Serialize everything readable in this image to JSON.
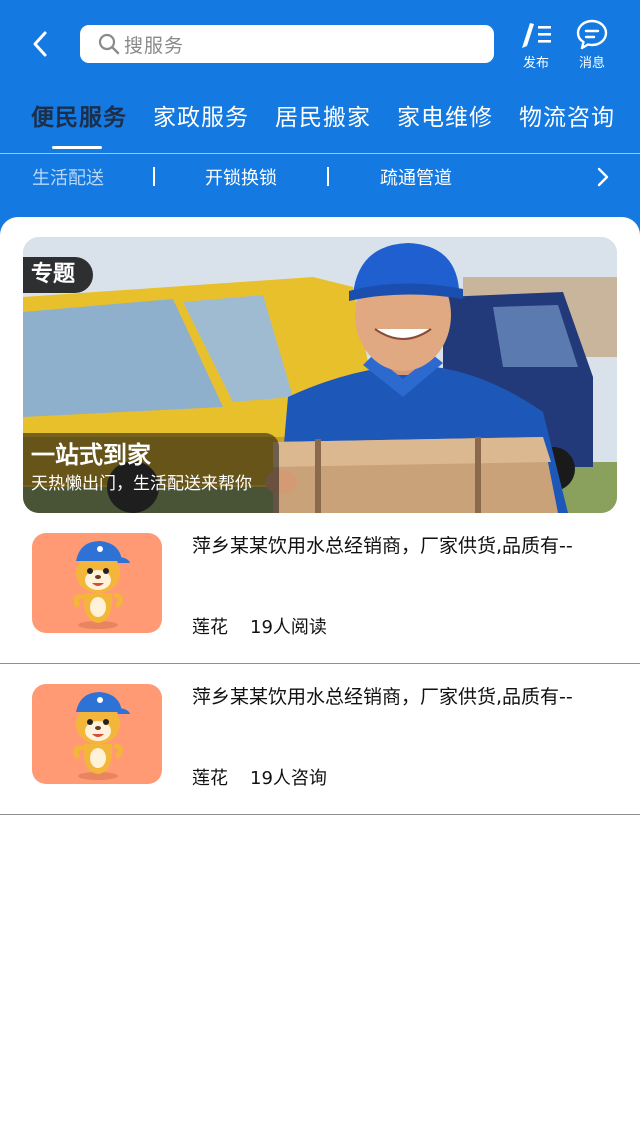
{
  "header": {
    "search_placeholder": "搜服务",
    "publish_label": "发布",
    "messages_label": "消息"
  },
  "main_tabs": [
    {
      "label": "便民服务",
      "active": true
    },
    {
      "label": "家政服务",
      "active": false
    },
    {
      "label": "居民搬家",
      "active": false
    },
    {
      "label": "家电维修",
      "active": false
    },
    {
      "label": "物流咨询",
      "active": false
    }
  ],
  "sub_tabs": [
    {
      "label": "生活配送",
      "active": true
    },
    {
      "label": "开锁换锁",
      "active": false
    },
    {
      "label": "疏通管道",
      "active": false
    }
  ],
  "banner": {
    "tag": "专题",
    "title": "一站式到家",
    "subtitle": "天热懒出门，生活配送来帮你"
  },
  "list": [
    {
      "title": "萍乡某某饮用水总经销商，厂家供货,品质有--",
      "author": "莲花",
      "stat": "19人阅读"
    },
    {
      "title": "萍乡某某饮用水总经销商，厂家供货,品质有--",
      "author": "莲花",
      "stat": "19人咨询"
    }
  ],
  "colors": {
    "brand_blue": "#1479e0",
    "thumb_bg": "#ff9a74",
    "active_tab_text": "#1c2f4a"
  },
  "icons": [
    "back-arrow-icon",
    "search-icon",
    "publish-icon",
    "message-icon",
    "chevron-right-icon"
  ]
}
